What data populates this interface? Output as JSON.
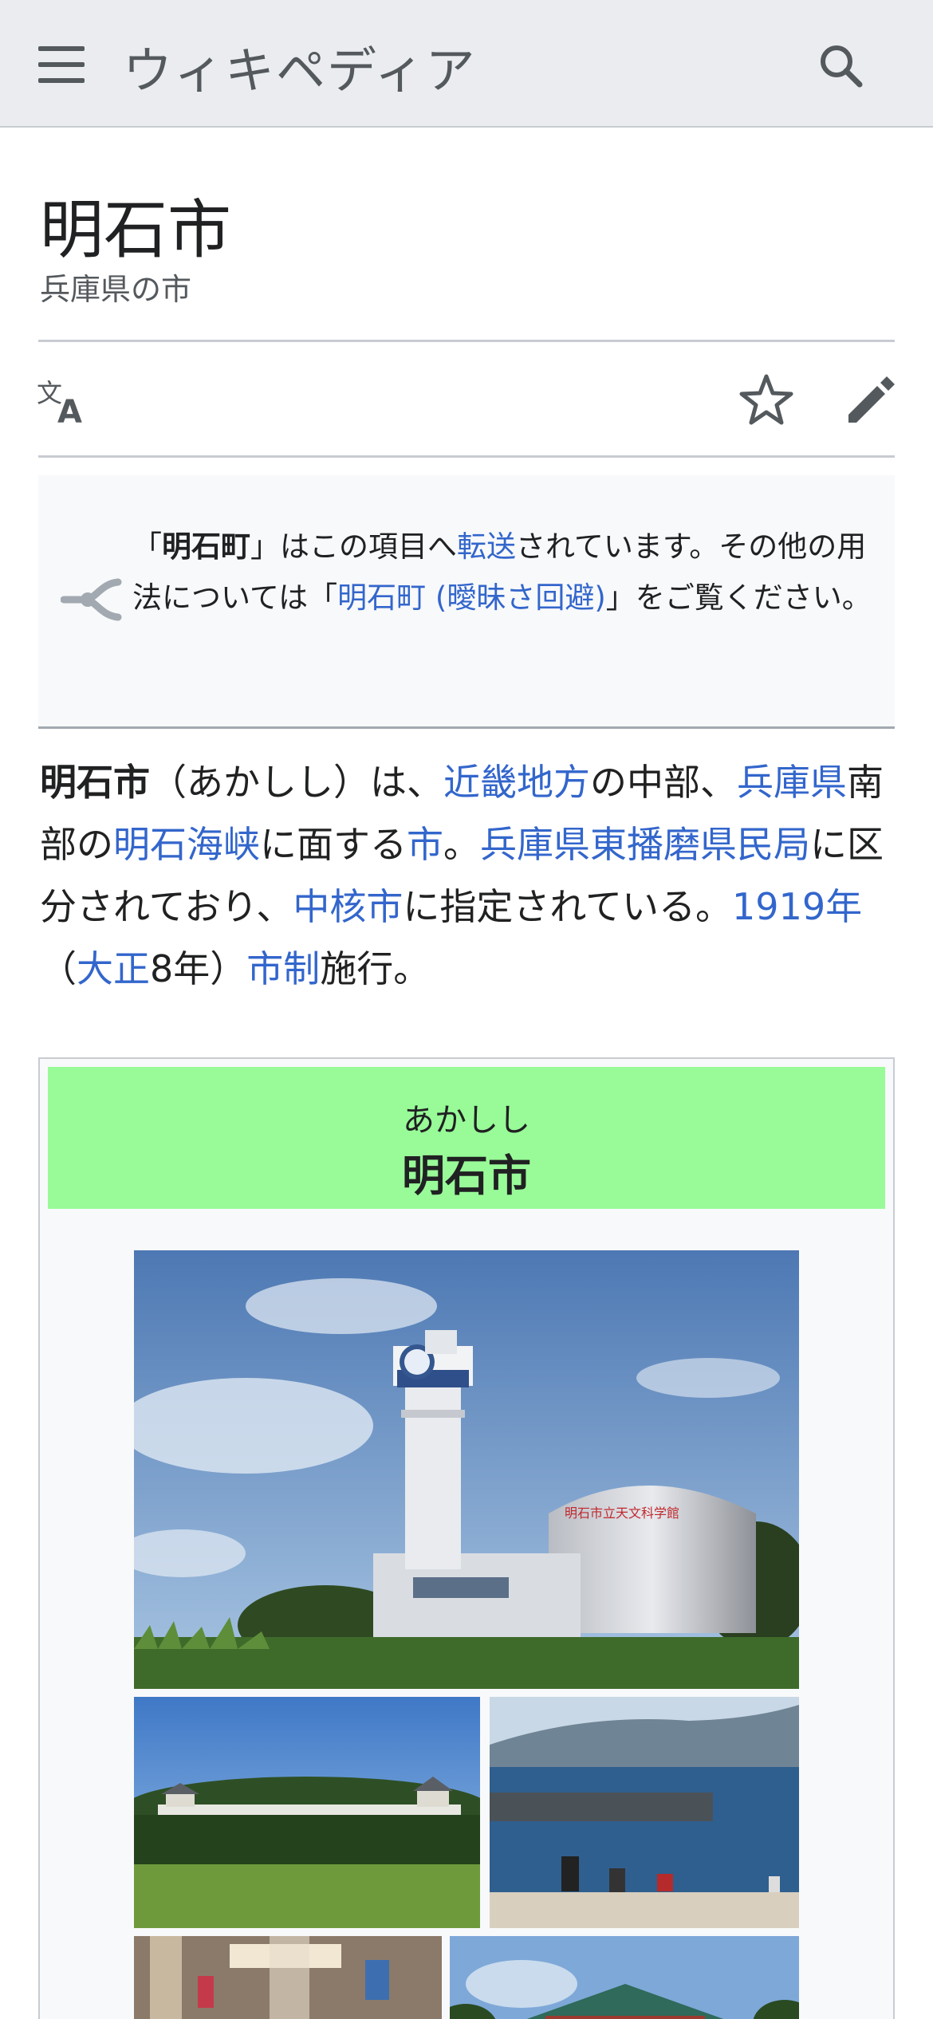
{
  "header": {
    "wordmark": "ウィキペディア"
  },
  "page": {
    "title": "明石市",
    "subtitle": "兵庫県の市"
  },
  "hatnote": {
    "open_quote": "「",
    "bold_term": "明石町",
    "part1": "」はこの項目へ",
    "link1": "転送",
    "part2": "されています。その他の用法については「",
    "link2": "明石町 (曖昧さ回避)",
    "part3": "」をご覧ください。"
  },
  "lead": {
    "bold": "明石市",
    "t1": "（あかしし）は、",
    "l1": "近畿地方",
    "t2": "の中部、",
    "l2": "兵庫県",
    "t3": "南部の",
    "l3": "明石海峡",
    "t4": "に面する",
    "l4": "市",
    "t5": "。",
    "l5": "兵庫県東播磨県民局",
    "t6": "に区分されており、",
    "l6": "中核市",
    "t7": "に指定されている。",
    "l7": "1919年",
    "t8": "（",
    "l8": "大正",
    "t9": "8年）",
    "l9": "市制",
    "t10": "施行。"
  },
  "infobox": {
    "kana": "あかしし",
    "name": "明石市",
    "header_color": "#98fb98"
  },
  "colors": {
    "link": "#3366cc",
    "text": "#202122",
    "header_bg": "#eaecf0"
  }
}
